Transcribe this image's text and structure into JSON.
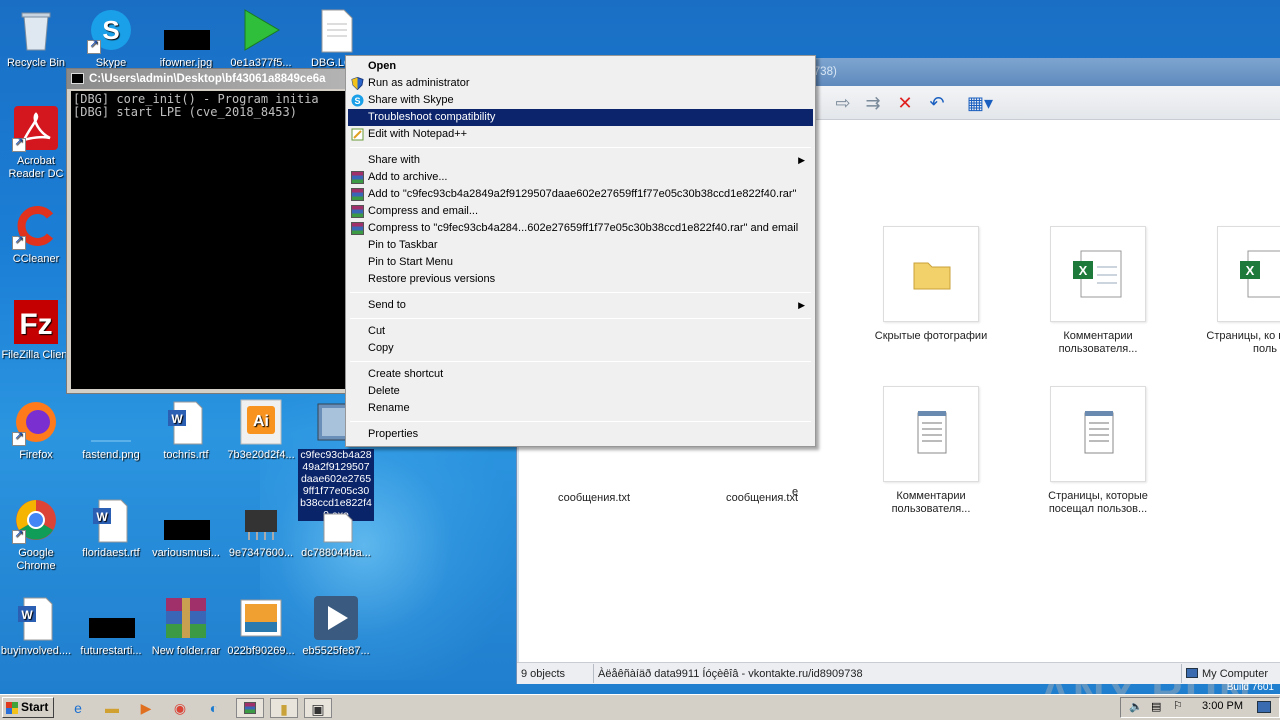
{
  "desktop": {
    "icons": [
      {
        "label": "Recycle Bin",
        "icon": "recycle-bin-icon"
      },
      {
        "label": "Skype",
        "icon": "skype-icon"
      },
      {
        "label": "ifowner.jpg",
        "icon": "image-file-icon"
      },
      {
        "label": "0e1a377f5...",
        "icon": "media-player-icon"
      },
      {
        "label": "DBG.LOG",
        "icon": "text-file-icon"
      },
      {
        "label": "Acrobat Reader DC",
        "icon": "acrobat-icon"
      },
      {
        "label": "CCleaner",
        "icon": "ccleaner-icon"
      },
      {
        "label": "FileZilla Client",
        "icon": "filezilla-icon"
      },
      {
        "label": "Firefox",
        "icon": "firefox-icon"
      },
      {
        "label": "fastend.png",
        "icon": "image-file-icon"
      },
      {
        "label": "tochris.rtf",
        "icon": "word-doc-icon"
      },
      {
        "label": "7b3e20d2f4...",
        "icon": "illustrator-icon"
      },
      {
        "label": "c9fec93cb4a2849a2f9129507daae602e27659ff1f77e05c30b38ccd1e822f40.exe",
        "icon": "exe-icon"
      },
      {
        "label": "Google Chrome",
        "icon": "chrome-icon"
      },
      {
        "label": "floridaest.rtf",
        "icon": "word-doc-icon"
      },
      {
        "label": "variousmusi...",
        "icon": "image-file-icon"
      },
      {
        "label": "9e7347600...",
        "icon": "chip-icon"
      },
      {
        "label": "dc788044ba...",
        "icon": "file-icon"
      },
      {
        "label": "buyinvolved....",
        "icon": "word-doc-icon"
      },
      {
        "label": "futurestarti...",
        "icon": "image-file-icon"
      },
      {
        "label": "New folder.rar",
        "icon": "winrar-icon"
      },
      {
        "label": "022bf90269...",
        "icon": "photo-icon"
      },
      {
        "label": "eb5525fe87...",
        "icon": "video-file-icon"
      }
    ]
  },
  "console": {
    "title": "C:\\Users\\admin\\Desktop\\bf43061a8849ce6a",
    "lines": "[DBG] core_init() - Program initia\n[DBG] start LPE (cve_2018_8453)"
  },
  "explorer": {
    "title": "09738)",
    "files": [
      {
        "label": "Скрытые фотографии",
        "icon": "folder-icon"
      },
      {
        "label": "Комментарии пользователя...",
        "icon": "excel-icon"
      },
      {
        "label": "Страницы, ко посещал поль",
        "icon": "excel-icon"
      },
      {
        "label": "Комментарии пользователя...",
        "icon": "notepad-icon"
      },
      {
        "label": "Страницы, которые посещал пользов...",
        "icon": "notepad-icon"
      },
      {
        "label": "сообщения.txt",
        "icon": "notepad-icon"
      },
      {
        "label": "сообщения.txt",
        "icon": "notepad-icon"
      },
      {
        "label": "е",
        "icon": "none"
      },
      {
        "label": "е",
        "icon": "none"
      }
    ],
    "status": {
      "count": "9 objects",
      "info": "Àëåêñàíäð data9911 Íóçèêîâ - vkontakte.ru/id8909738",
      "location": "My Computer"
    }
  },
  "context_menu": {
    "items": [
      {
        "label": "Open",
        "bold": true
      },
      {
        "label": "Run as administrator",
        "icon": "shield-icon"
      },
      {
        "label": "Share with Skype",
        "icon": "skype-icon"
      },
      {
        "label": "Troubleshoot compatibility",
        "highlighted": true
      },
      {
        "label": "Edit with Notepad++",
        "icon": "notepadpp-icon"
      },
      {
        "label": "Share with",
        "submenu": true
      },
      {
        "label": "Add to archive...",
        "icon": "winrar-icon"
      },
      {
        "label": "Add to \"c9fec93cb4a2849a2f9129507daae602e27659ff1f77e05c30b38ccd1e822f40.rar\"",
        "icon": "winrar-icon"
      },
      {
        "label": "Compress and email...",
        "icon": "winrar-icon"
      },
      {
        "label": "Compress to \"c9fec93cb4a284...602e27659ff1f77e05c30b38ccd1e822f40.rar\" and email",
        "icon": "winrar-icon"
      },
      {
        "label": "Pin to Taskbar"
      },
      {
        "label": "Pin to Start Menu"
      },
      {
        "label": "Restore previous versions"
      },
      {
        "label": "Send to",
        "submenu": true
      },
      {
        "label": "Cut"
      },
      {
        "label": "Copy"
      },
      {
        "label": "Create shortcut"
      },
      {
        "label": "Delete"
      },
      {
        "label": "Rename"
      },
      {
        "label": "Properties"
      }
    ]
  },
  "taskbar": {
    "start_label": "Start",
    "clock": "3:00 PM",
    "build": "Build 7601"
  },
  "watermark": "ANY RUN"
}
